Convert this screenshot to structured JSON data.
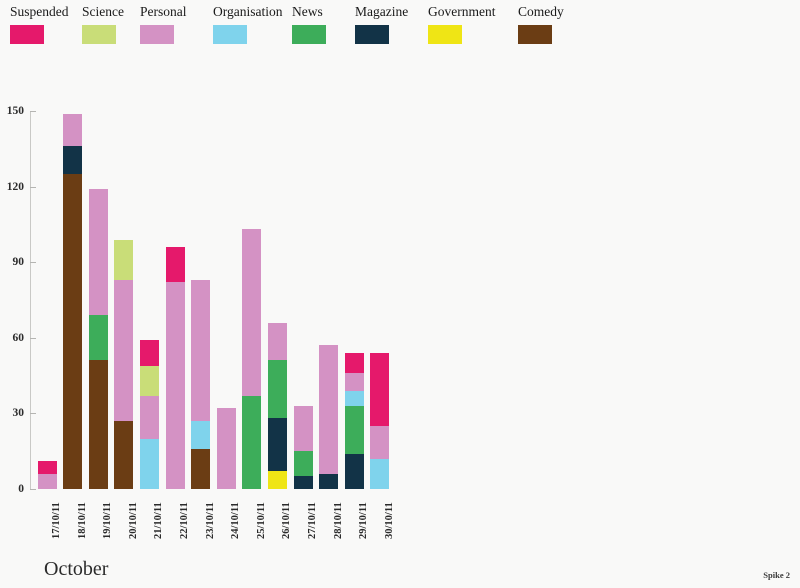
{
  "chart_data": {
    "type": "bar",
    "stacked": true,
    "title": "",
    "subtitle": "",
    "xlabel": "",
    "ylabel": "",
    "month_label": "October",
    "caption": "Spike 2",
    "grid": false,
    "legend_position": "top",
    "ylim": [
      0,
      150
    ],
    "yticks": [
      0,
      30,
      60,
      90,
      120,
      150
    ],
    "ytick_labels": [
      "0",
      "30",
      "60",
      "90",
      "120",
      "150"
    ],
    "categories": [
      "17/10/11",
      "18/10/11",
      "19/10/11",
      "20/10/11",
      "21/10/11",
      "22/10/11",
      "23/10/11",
      "24/10/11",
      "25/10/11",
      "26/10/11",
      "27/10/11",
      "28/10/11",
      "29/10/11",
      "30/10/11"
    ],
    "series": [
      {
        "name": "Comedy",
        "color": "#6b3d14",
        "values": [
          0,
          125,
          51,
          27,
          0,
          0,
          16,
          0,
          0,
          0,
          0,
          0,
          0,
          0
        ]
      },
      {
        "name": "Government",
        "color": "#efe515",
        "values": [
          0,
          0,
          0,
          0,
          0,
          0,
          0,
          0,
          0,
          7,
          0,
          0,
          0,
          0
        ]
      },
      {
        "name": "Magazine",
        "color": "#123347",
        "values": [
          0,
          11,
          0,
          0,
          0,
          0,
          0,
          0,
          0,
          21,
          5,
          6,
          14,
          0
        ]
      },
      {
        "name": "News",
        "color": "#3dad5a",
        "values": [
          0,
          0,
          18,
          0,
          0,
          0,
          0,
          0,
          37,
          23,
          10,
          0,
          19,
          0
        ]
      },
      {
        "name": "Organisation",
        "color": "#7fd3ec",
        "values": [
          0,
          0,
          0,
          0,
          20,
          0,
          11,
          0,
          0,
          0,
          0,
          0,
          6,
          12
        ]
      },
      {
        "name": "Personal",
        "color": "#d492c4",
        "values": [
          6,
          13,
          50,
          56,
          17,
          82,
          56,
          32,
          66,
          15,
          18,
          51,
          7,
          13
        ]
      },
      {
        "name": "Science",
        "color": "#c9dd78",
        "values": [
          0,
          0,
          0,
          16,
          12,
          0,
          0,
          0,
          0,
          0,
          0,
          0,
          0,
          0
        ]
      },
      {
        "name": "Suspended",
        "color": "#e5196b",
        "values": [
          5,
          0,
          0,
          0,
          10,
          14,
          0,
          0,
          0,
          0,
          0,
          0,
          8,
          29
        ]
      }
    ],
    "totals": [
      11,
      149,
      119,
      99,
      59,
      96,
      83,
      32,
      103,
      66,
      33,
      57,
      54,
      54
    ]
  },
  "legend": {
    "items": [
      {
        "label": "Suspended",
        "color": "#e5196b"
      },
      {
        "label": "Science",
        "color": "#c9dd78"
      },
      {
        "label": "Personal",
        "color": "#d492c4"
      },
      {
        "label": "Organisation",
        "color": "#7fd3ec"
      },
      {
        "label": "News",
        "color": "#3dad5a"
      },
      {
        "label": "Magazine",
        "color": "#123347"
      },
      {
        "label": "Government",
        "color": "#efe515"
      },
      {
        "label": "Comedy",
        "color": "#6b3d14"
      }
    ]
  },
  "footer": {
    "month": "October",
    "caption": "Spike 2"
  }
}
